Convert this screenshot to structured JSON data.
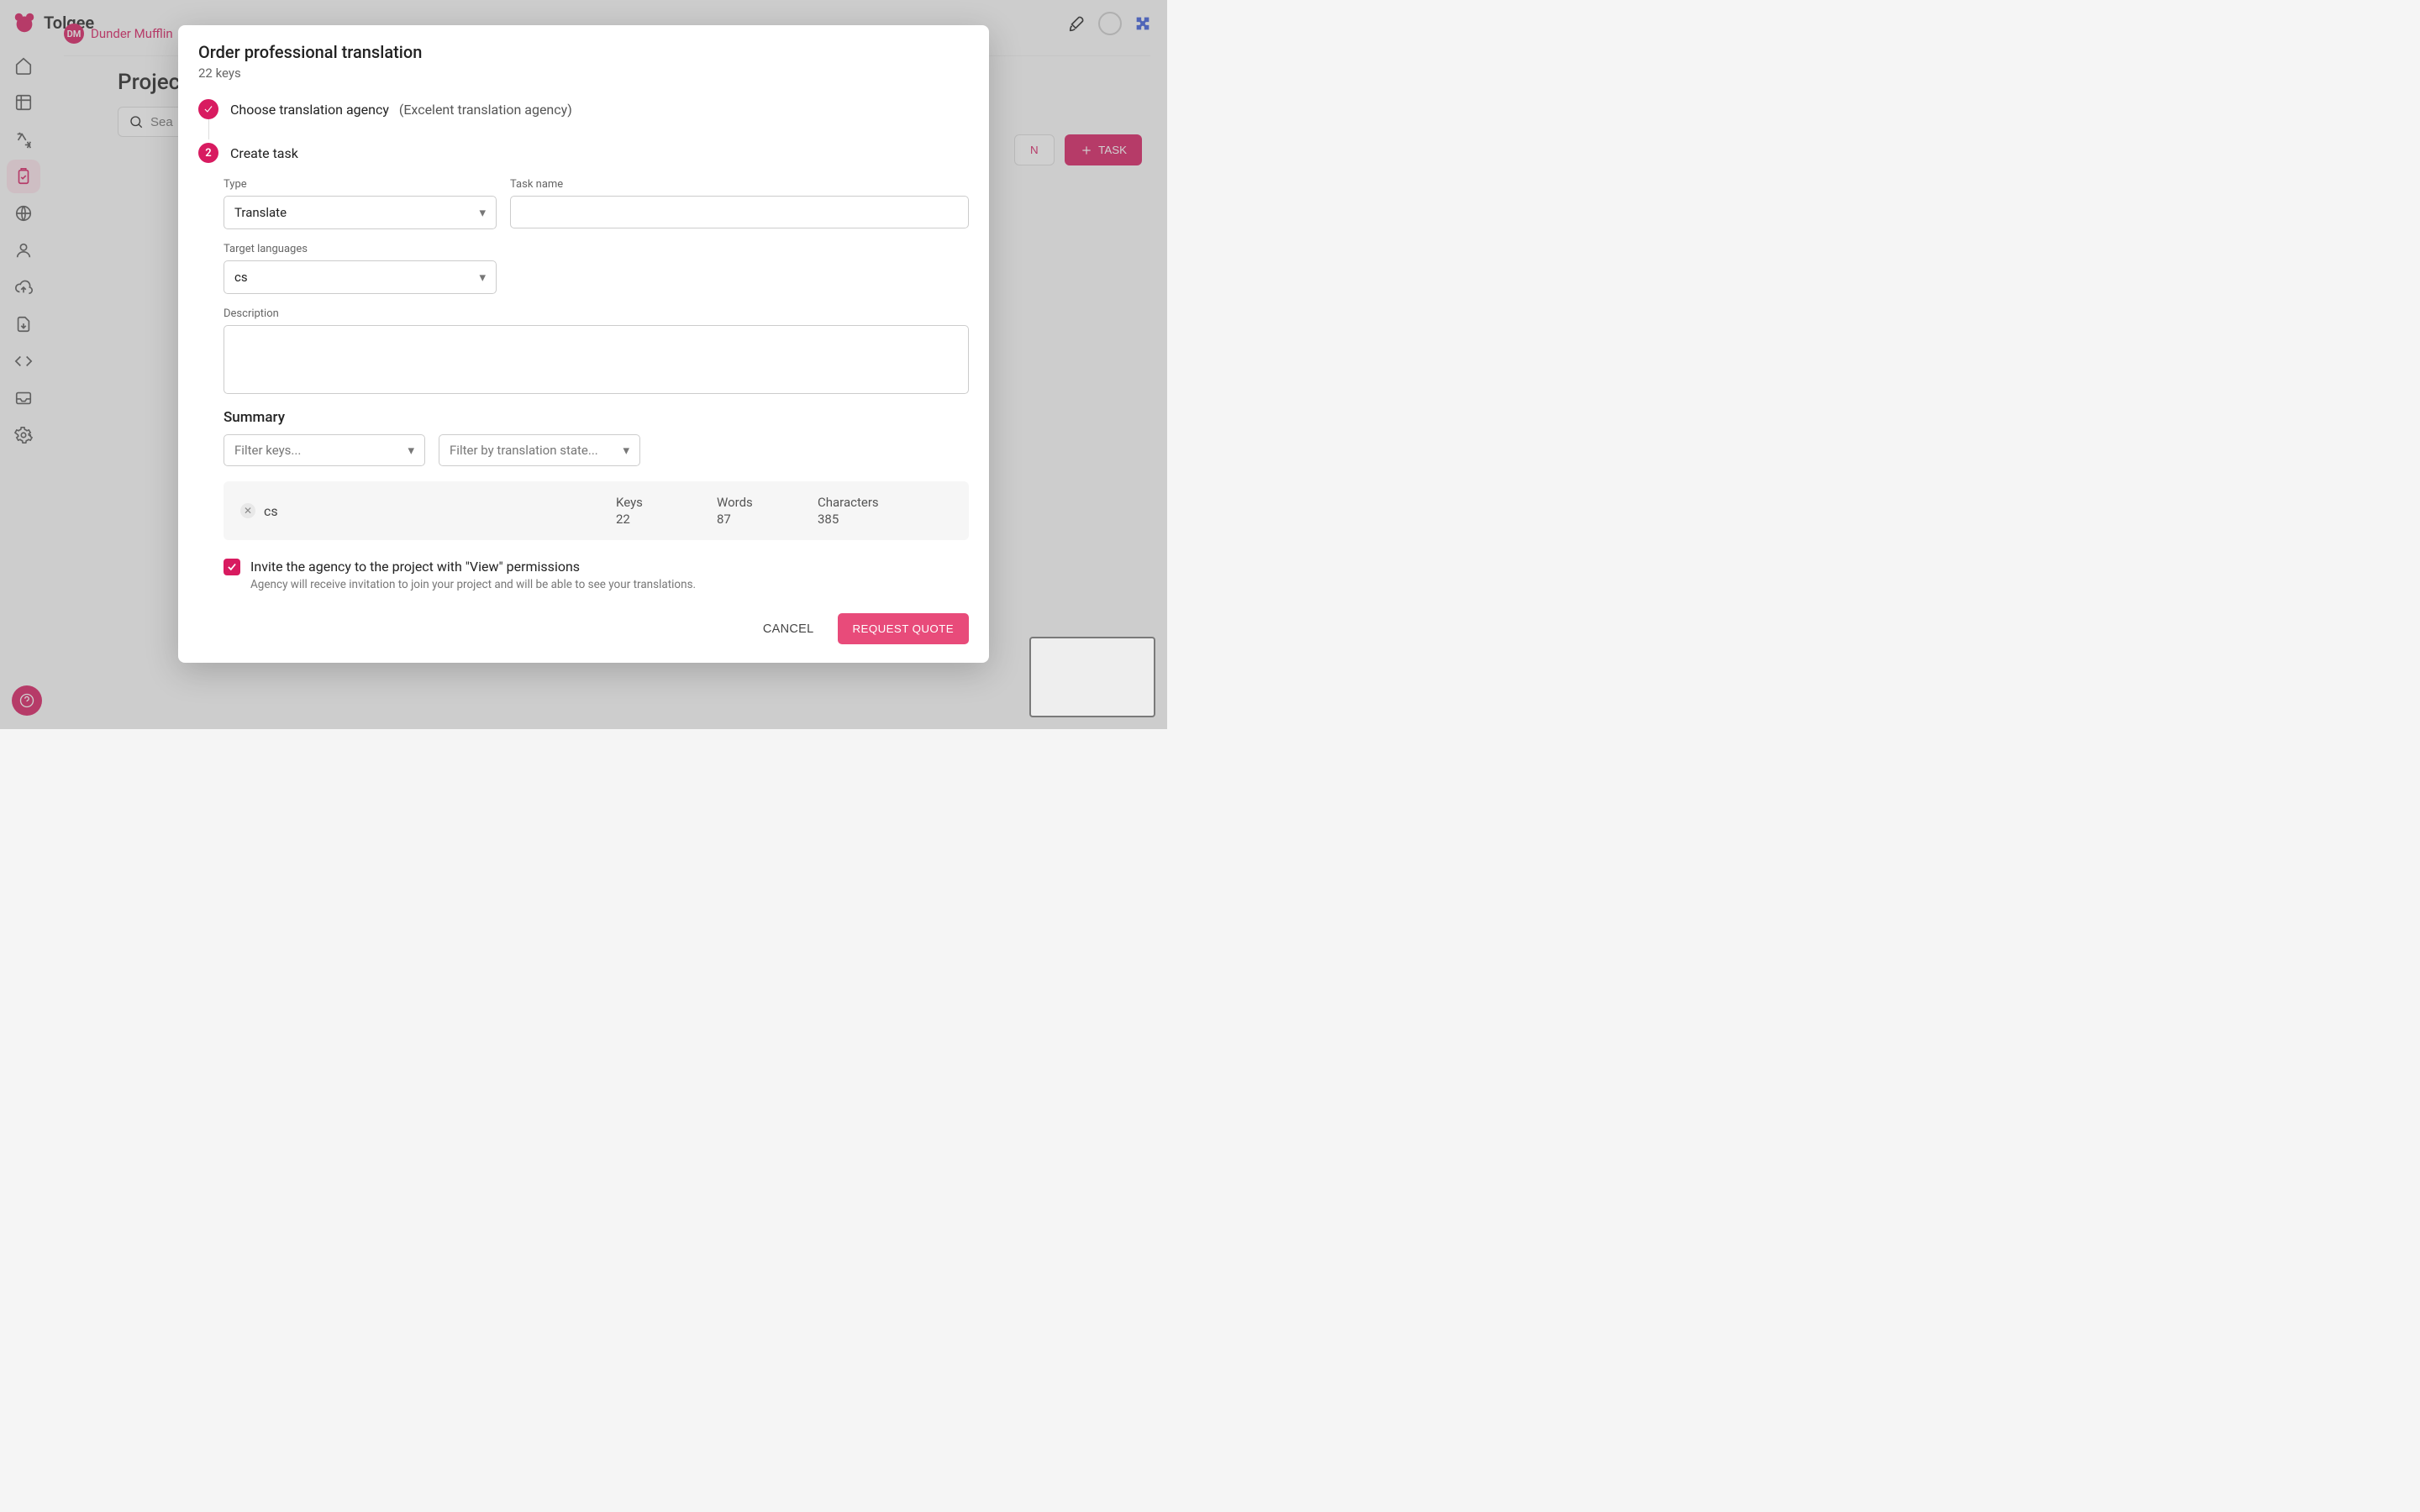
{
  "brand": "Tolgee",
  "breadcrumb": {
    "project_badge": "DM",
    "project_name": "Dunder Mufflin"
  },
  "page": {
    "title": "Project"
  },
  "search": {
    "placeholder": "Sea"
  },
  "toolbar": {
    "order_translation_button": "N",
    "task_button": "TASK"
  },
  "modal": {
    "title": "Order professional translation",
    "subtitle": "22 keys",
    "step1": {
      "label": "Choose translation agency",
      "selected": "(Excelent translation agency)"
    },
    "step2": {
      "number": "2",
      "label": "Create task"
    },
    "fields": {
      "type_label": "Type",
      "type_value": "Translate",
      "task_name_label": "Task name",
      "task_name_value": "",
      "languages_label": "Target languages",
      "languages_value": "cs",
      "description_label": "Description",
      "description_value": ""
    },
    "summary": {
      "title": "Summary",
      "filter_keys_placeholder": "Filter keys...",
      "filter_state_placeholder": "Filter by translation state...",
      "row": {
        "lang": "cs",
        "keys_label": "Keys",
        "keys_value": "22",
        "words_label": "Words",
        "words_value": "87",
        "chars_label": "Characters",
        "chars_value": "385"
      }
    },
    "invite": {
      "checked": true,
      "title": "Invite the agency to the project with \"View\" permissions",
      "subtitle": "Agency will receive invitation to join your project and will be able to see your translations."
    },
    "actions": {
      "cancel": "CANCEL",
      "submit": "REQUEST QUOTE"
    }
  }
}
